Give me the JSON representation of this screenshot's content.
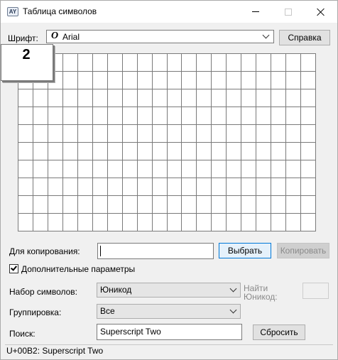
{
  "window": {
    "title": "Таблица символов",
    "icon": "char-map-app-icon"
  },
  "font_row": {
    "label": "Шрифт:",
    "font_glyph": "O",
    "font_value": "Arial",
    "help_button": "Справка"
  },
  "grid": {
    "rows": 10,
    "cols": 20,
    "selected_char": "2"
  },
  "copy_row": {
    "label": "Для копирования:",
    "value": "",
    "select_button": "Выбрать",
    "copy_button": "Копировать"
  },
  "advanced": {
    "label": "Дополнительные параметры",
    "checked": true
  },
  "charset": {
    "label": "Набор символов:",
    "value": "Юникод",
    "find_unicode_label_1": "Найти",
    "find_unicode_label_2": "Юникод:",
    "find_unicode_value": ""
  },
  "grouping": {
    "label": "Группировка:",
    "value": "Все"
  },
  "search": {
    "label": "Поиск:",
    "value": "Superscript Two",
    "reset_button": "Сбросить"
  },
  "status": {
    "text": "U+00B2: Superscript Two"
  }
}
